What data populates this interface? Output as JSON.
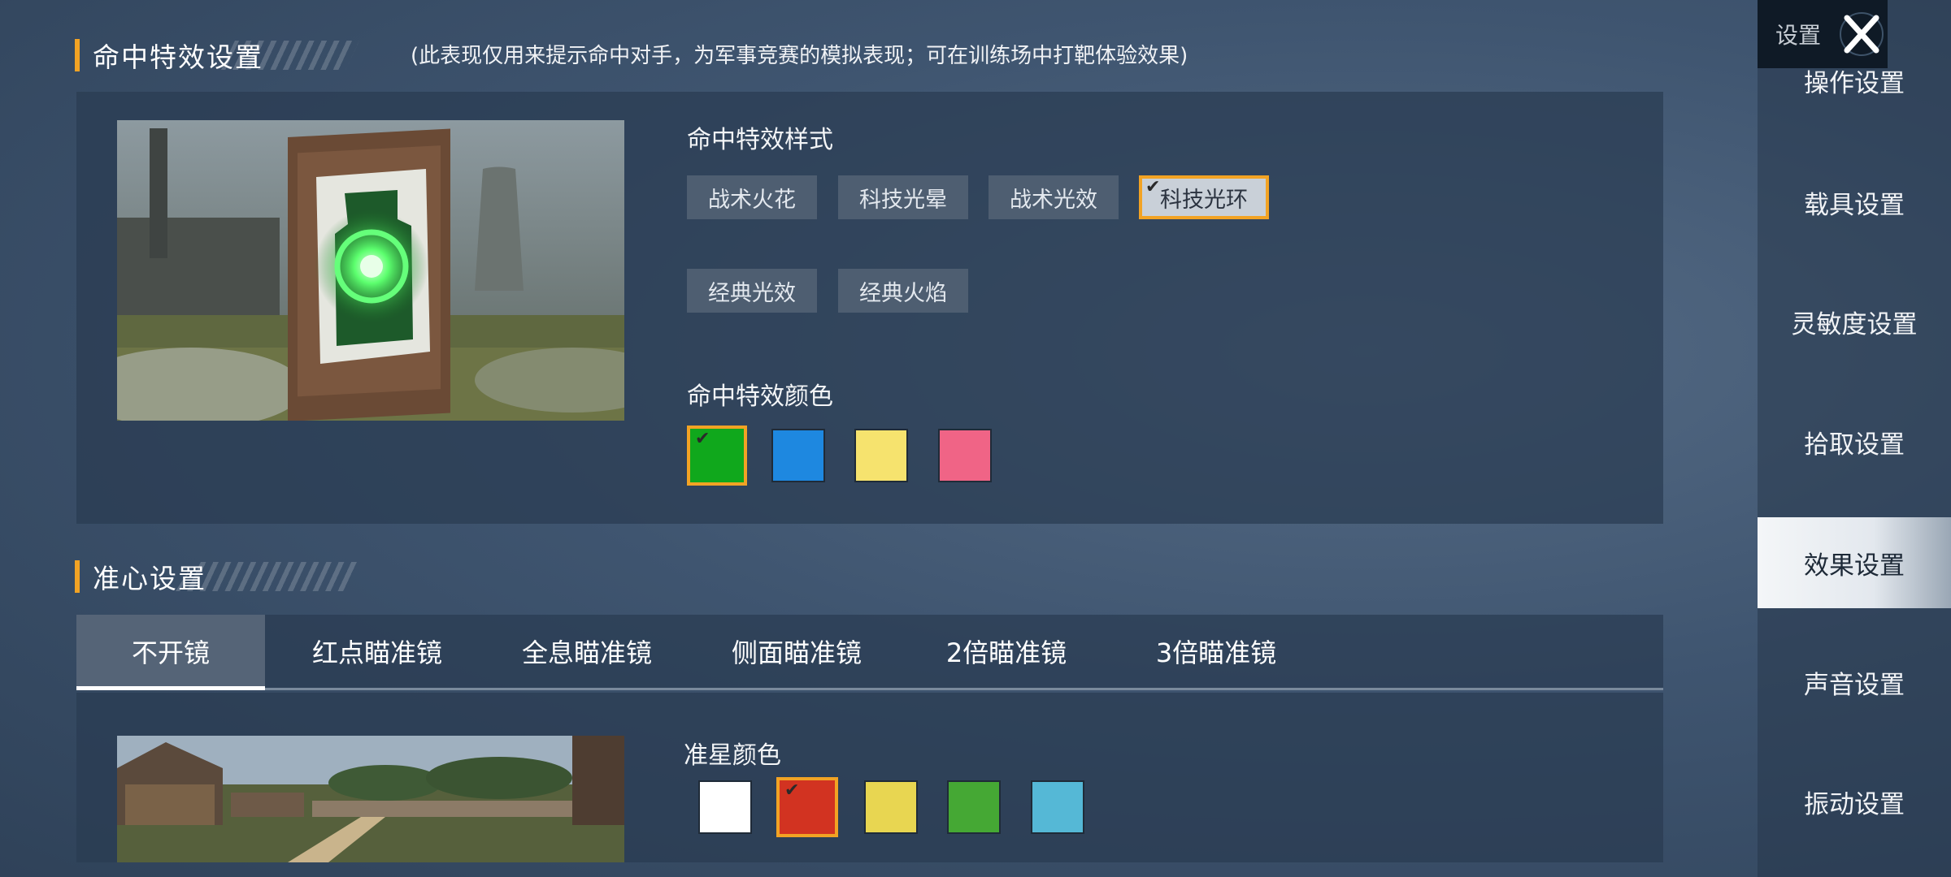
{
  "hit_effect": {
    "title": "命中特效设置",
    "hint": "(此表现仅用来提示命中对手，为军事竞赛的模拟表现；可在训练场中打靶体验效果)",
    "style_label": "命中特效样式",
    "styles": [
      "战术火花",
      "科技光晕",
      "战术光效",
      "科技光环",
      "经典光效",
      "经典火焰"
    ],
    "selected_style": "科技光环",
    "color_label": "命中特效颜色",
    "colors": [
      "#10a81c",
      "#1e88e0",
      "#f6e36e",
      "#f06486"
    ],
    "selected_color_index": 0
  },
  "crosshair": {
    "title": "准心设置",
    "tabs": [
      "不开镜",
      "红点瞄准镜",
      "全息瞄准镜",
      "侧面瞄准镜",
      "2倍瞄准镜",
      "3倍瞄准镜"
    ],
    "active_tab": "不开镜",
    "color_label": "准星颜色",
    "colors": [
      "#ffffff",
      "#d23321",
      "#e8d651",
      "#45a834",
      "#55b8d6"
    ],
    "selected_color_index": 1
  },
  "sidebar": {
    "top_label": "设置",
    "close_icon": "close-x-icon",
    "items": [
      "操作设置",
      "载具设置",
      "灵敏度设置",
      "拾取设置",
      "效果设置",
      "声音设置",
      "振动设置"
    ],
    "active_item": "效果设置"
  }
}
